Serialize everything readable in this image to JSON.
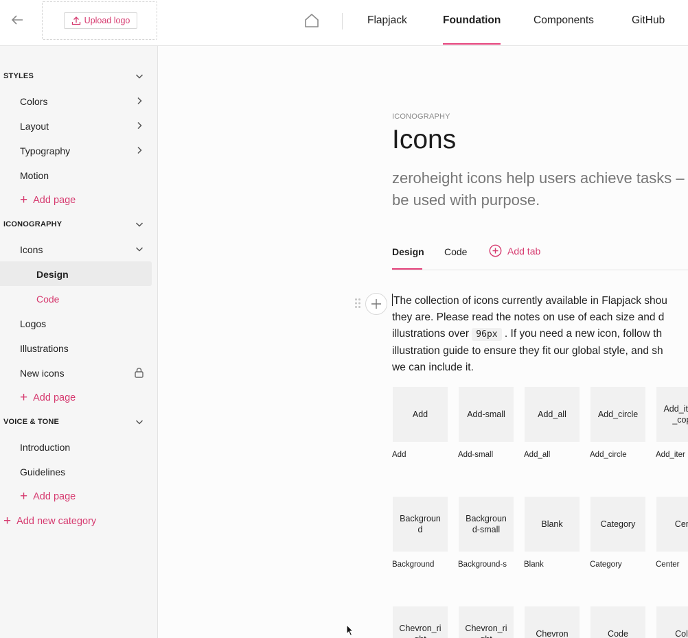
{
  "header": {
    "upload_logo_label": "Upload logo",
    "nav": [
      {
        "label": "Flapjack"
      },
      {
        "label": "Foundation"
      },
      {
        "label": "Components"
      },
      {
        "label": "GitHub"
      }
    ]
  },
  "sidebar": {
    "categories": [
      {
        "title": "STYLES",
        "items": [
          "Colors",
          "Layout",
          "Typography",
          "Motion"
        ],
        "add_label": "Add page"
      },
      {
        "title": "ICONOGRAPHY",
        "items": [
          "Icons",
          "Logos",
          "Illustrations",
          "New icons"
        ],
        "subitems": [
          "Design",
          "Code"
        ],
        "add_label": "Add page"
      },
      {
        "title": "VOICE & TONE",
        "items": [
          "Introduction",
          "Guidelines"
        ],
        "add_label": "Add page"
      }
    ],
    "add_category_label": "Add new category"
  },
  "page": {
    "eyebrow": "ICONOGRAPHY",
    "title": "Icons",
    "lede_line1": "zeroheight icons help users achieve tasks –",
    "lede_line2": "be used with purpose.",
    "tabs": [
      {
        "label": "Design"
      },
      {
        "label": "Code"
      }
    ],
    "add_tab_label": "Add tab",
    "body": {
      "line1": "The collection of icons currently available in Flapjack shou",
      "line2": "they are. Please read the notes on use of each size and d",
      "line3_pre": "illustrations over ",
      "line3_code": "96px",
      "line3_post": " . If you need a new icon, follow th",
      "line4": "illustration guide to ensure they fit our global style, and sh",
      "line5": "we can include it."
    },
    "icons_row1": [
      {
        "tile": "Add",
        "caption": "Add"
      },
      {
        "tile": "Add-small",
        "caption": "Add-small"
      },
      {
        "tile": "Add_all",
        "caption": "Add_all"
      },
      {
        "tile": "Add_circle",
        "caption": "Add_circle"
      },
      {
        "tile": "Add_items_copy",
        "caption": "Add_iter"
      }
    ],
    "icons_row2": [
      {
        "tile": "Background",
        "caption": "Background"
      },
      {
        "tile": "Background-small",
        "caption": "Background-s"
      },
      {
        "tile": "Blank",
        "caption": "Blank"
      },
      {
        "tile": "Category",
        "caption": "Category"
      },
      {
        "tile": "Cent",
        "caption": "Center"
      }
    ],
    "icons_row3": [
      {
        "tile": "Chevron_right",
        "caption": ""
      },
      {
        "tile": "Chevron_right",
        "caption": ""
      },
      {
        "tile": "Chevron",
        "caption": ""
      },
      {
        "tile": "Code",
        "caption": ""
      },
      {
        "tile": "Colo",
        "caption": ""
      }
    ]
  },
  "colors": {
    "accent": "#e4417a",
    "accent_text": "#d63a6f",
    "sidebar_bg": "#f6f6f6",
    "tile_bg": "#f1f1f1"
  },
  "icons": {
    "back": "arrow-left-icon",
    "home": "home-icon",
    "upload": "upload-icon",
    "chevron": "chevron-icon",
    "lock": "lock-icon",
    "add": "plus-icon",
    "drag": "drag-handle-icon"
  }
}
